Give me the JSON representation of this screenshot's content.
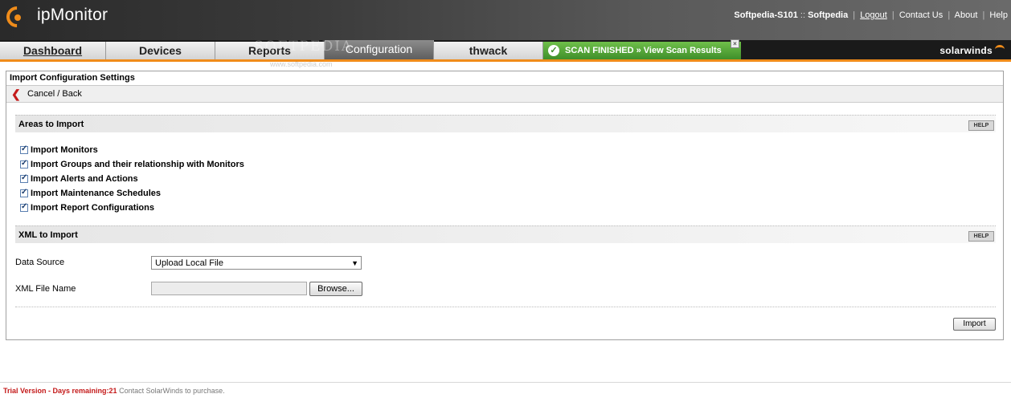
{
  "app": {
    "name": "ipMonitor",
    "brand": "solarwinds"
  },
  "header": {
    "user": "Softpedia-S101",
    "separator": "::",
    "org": "Softpedia",
    "links": [
      "Logout",
      "Contact Us",
      "About",
      "Help"
    ]
  },
  "tabs": [
    {
      "label": "Dashboard",
      "active": false
    },
    {
      "label": "Devices",
      "active": false
    },
    {
      "label": "Reports",
      "active": false
    },
    {
      "label": "Configuration",
      "active": true
    },
    {
      "label": "thwack",
      "active": false
    }
  ],
  "scan": {
    "label": "SCAN FINISHED » View Scan Results",
    "close": "×"
  },
  "panel": {
    "title": "Import Configuration Settings",
    "cancel_label": "Cancel / Back"
  },
  "areas": {
    "heading": "Areas to Import",
    "help": "HELP",
    "items": [
      {
        "label": "Import Monitors",
        "checked": true
      },
      {
        "label": "Import Groups and their relationship with Monitors",
        "checked": true
      },
      {
        "label": "Import Alerts and Actions",
        "checked": true
      },
      {
        "label": "Import Maintenance Schedules",
        "checked": true
      },
      {
        "label": "Import Report Configurations",
        "checked": true
      }
    ]
  },
  "xml": {
    "heading": "XML to Import",
    "help": "HELP",
    "data_source_label": "Data Source",
    "data_source_value": "Upload Local File",
    "file_name_label": "XML File Name",
    "file_name_value": "",
    "browse_label": "Browse..."
  },
  "import_label": "Import",
  "footer": {
    "trial": "Trial Version - Days remaining:21",
    "contact": "Contact SolarWinds to purchase."
  },
  "watermark": {
    "big": "SOFTPEDIA",
    "small": "www.softpedia.com"
  },
  "colors": {
    "accent": "#f08c1a",
    "scan_green": "#4f9f35",
    "trial_red": "#c41a1a"
  }
}
